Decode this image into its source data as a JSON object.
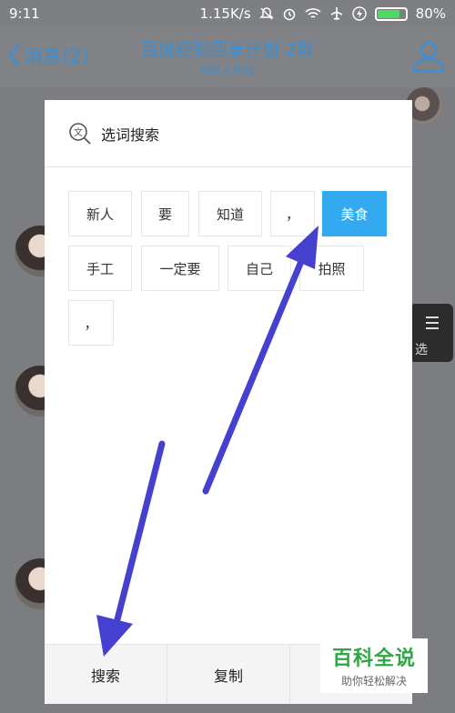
{
  "status_bar": {
    "time": "9:11",
    "speed": "1.15K/s",
    "battery": "80%",
    "battery_level": 0.8
  },
  "header": {
    "back_label": "消息(2)",
    "title": "百度经验回享计划-2群",
    "subtitle": "692人在线"
  },
  "dialog": {
    "title": "选词搜索",
    "icon": "search-text-icon",
    "tokens": [
      {
        "label": "新人",
        "selected": false
      },
      {
        "label": "要",
        "selected": false
      },
      {
        "label": "知道",
        "selected": false
      },
      {
        "label": "，",
        "selected": false
      },
      {
        "label": "美食",
        "selected": true
      },
      {
        "label": "手工",
        "selected": false
      },
      {
        "label": "一定要",
        "selected": false
      },
      {
        "label": "自己",
        "selected": false
      },
      {
        "label": "拍照",
        "selected": false
      },
      {
        "label": "，",
        "selected": false
      }
    ],
    "footer": {
      "search_label": "搜索",
      "copy_label": "复制"
    },
    "selected_color": "#33aaf0"
  },
  "side_chip": {
    "label": "选"
  },
  "watermark": {
    "main": "百科全说",
    "sub": "助你轻松解决"
  },
  "colors": {
    "accent": "#3a8fd6",
    "arrow": "#4640d0",
    "brand_green": "#30a646"
  }
}
